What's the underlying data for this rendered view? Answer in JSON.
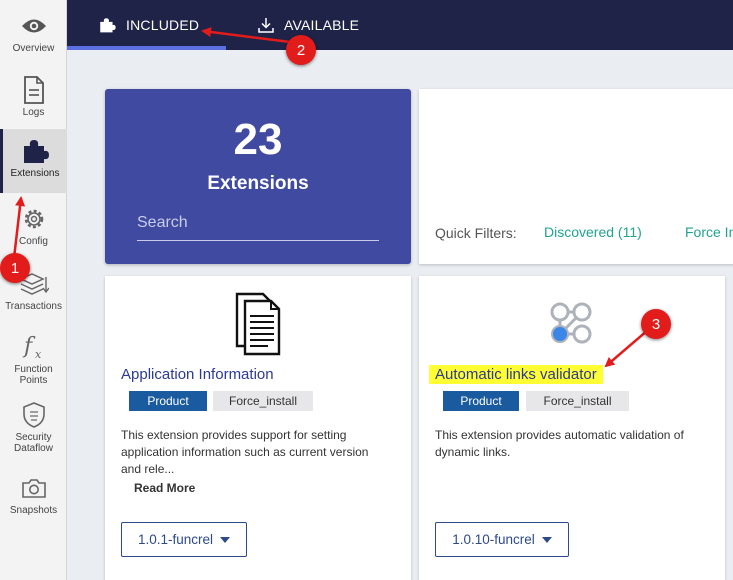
{
  "sidebar": {
    "items": [
      {
        "label": "Overview",
        "icon": "eye-icon"
      },
      {
        "label": "Logs",
        "icon": "document-icon"
      },
      {
        "label": "Extensions",
        "icon": "puzzle-icon"
      },
      {
        "label": "Config",
        "icon": "gear-icon"
      },
      {
        "label": "Transactions",
        "icon": "stack-icon"
      },
      {
        "label_line1": "Function",
        "label_line2": "Points",
        "icon": "fx-icon"
      },
      {
        "label_line1": "Security",
        "label_line2": "Dataflow",
        "icon": "shield-icon"
      },
      {
        "label": "Snapshots",
        "icon": "camera-icon"
      }
    ]
  },
  "tabs": {
    "included": "INCLUDED",
    "available": "AVAILABLE"
  },
  "summary": {
    "count": "23",
    "caption": "Extensions",
    "search_placeholder": "Search"
  },
  "filters": {
    "label": "Quick Filters:",
    "discovered": "Discovered (11)",
    "force_install": "Force In"
  },
  "cards": [
    {
      "title": "Application Information",
      "tags": [
        "Product",
        "Force_install"
      ],
      "description_line1": "This extension provides support for setting",
      "description_line2": "application information such as current version",
      "description_line3": "and rele...",
      "read_more": "Read More",
      "version": "1.0.1-funcrel"
    },
    {
      "title": "Automatic links validator",
      "tags": [
        "Product",
        "Force_install"
      ],
      "description_line1": "This extension provides automatic validation of",
      "description_line2": "dynamic links.",
      "version": "1.0.10-funcrel"
    }
  ],
  "annotations": {
    "badge1": "1",
    "badge2": "2",
    "badge3": "3"
  },
  "colors": {
    "topbar": "#1f2347",
    "accent": "#3f4aa0",
    "filter_link": "#22a38f",
    "tag_product": "#1a5b9f",
    "annotation_red": "#e21b1b",
    "highlight": "#ffff33"
  }
}
